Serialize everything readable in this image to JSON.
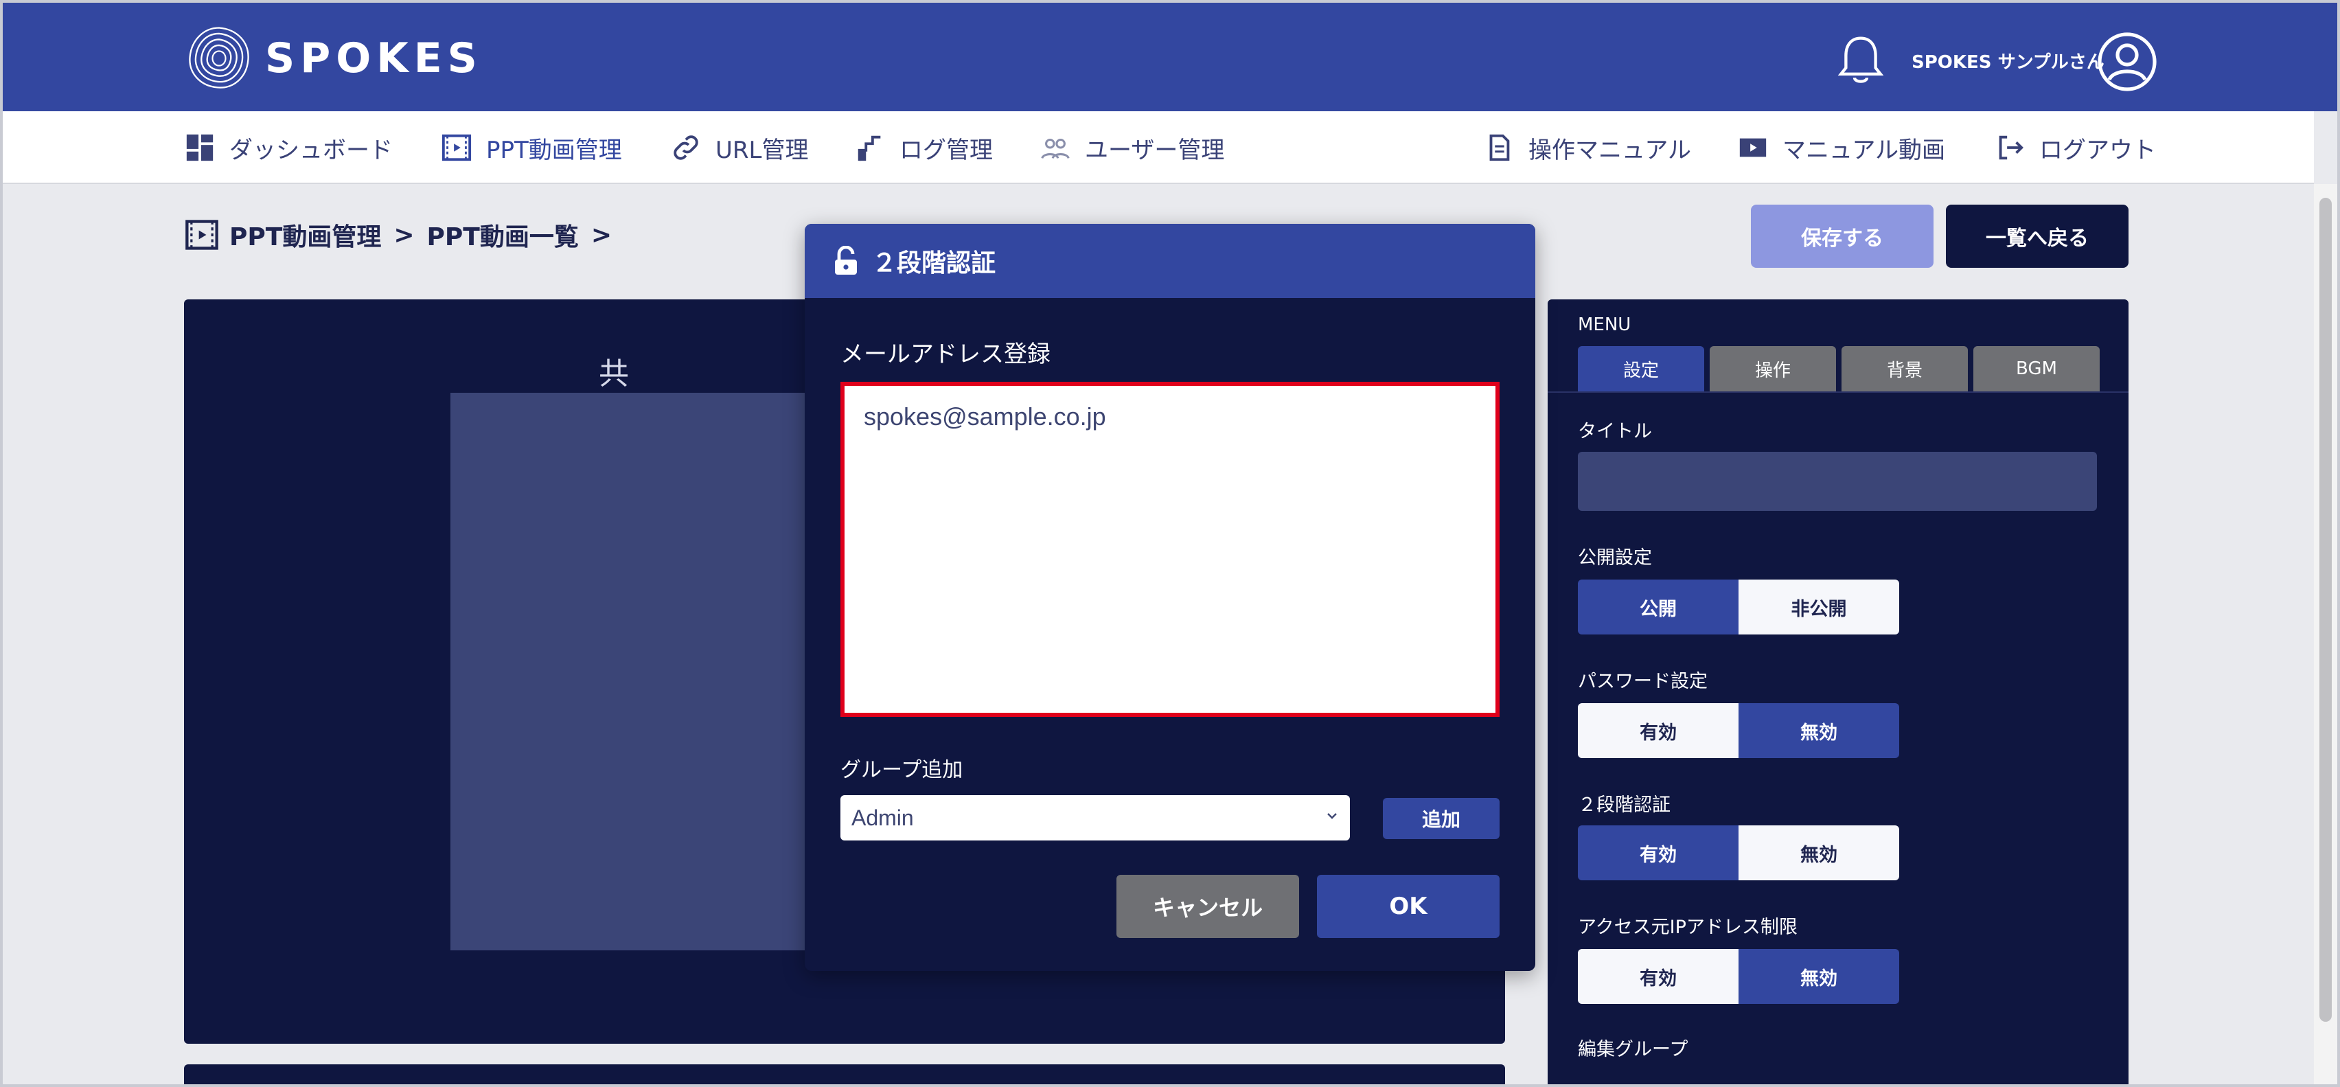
{
  "header": {
    "logo_text": "SPOKES",
    "user_name": "SPOKES サンプルさん"
  },
  "nav": {
    "items": [
      {
        "label": "ダッシュボード",
        "icon": "dashboard-icon"
      },
      {
        "label": "PPT動画管理",
        "icon": "film-icon"
      },
      {
        "label": "URL管理",
        "icon": "link-icon"
      },
      {
        "label": "ログ管理",
        "icon": "log-icon"
      },
      {
        "label": "ユーザー管理",
        "icon": "users-icon"
      }
    ],
    "right_items": [
      {
        "label": "操作マニュアル",
        "icon": "manual-icon"
      },
      {
        "label": "マニュアル動画",
        "icon": "video-icon"
      },
      {
        "label": "ログアウト",
        "icon": "logout-icon"
      }
    ]
  },
  "breadcrumb": {
    "level1": "PPT動画管理",
    "level2": "PPT動画一覧"
  },
  "actions": {
    "save": "保存する",
    "back": "一覧へ戻る"
  },
  "preview": {
    "partial_text": "共"
  },
  "side": {
    "menu_label": "MENU",
    "tabs": [
      "設定",
      "操作",
      "背景",
      "BGM"
    ],
    "title_label": "タイトル",
    "publish_label": "公開設定",
    "publish_on": "公開",
    "publish_off": "非公開",
    "password_label": "パスワード設定",
    "password_on": "有効",
    "password_off": "無効",
    "twofa_label": "２段階認証",
    "twofa_on": "有効",
    "twofa_off": "無効",
    "ip_label": "アクセス元IPアドレス制限",
    "ip_on": "有効",
    "ip_off": "無効",
    "edit_group_label": "編集グループ"
  },
  "modal": {
    "title": "２段階認証",
    "email_label": "メールアドレス登録",
    "email_value": "spokes@sample.co.jp",
    "group_label": "グループ追加",
    "group_selected": "Admin",
    "add": "追加",
    "cancel": "キャンセル",
    "ok": "OK"
  },
  "colors": {
    "primary": "#3347a0",
    "dark": "#0f1640",
    "highlight": "#e0001b"
  }
}
